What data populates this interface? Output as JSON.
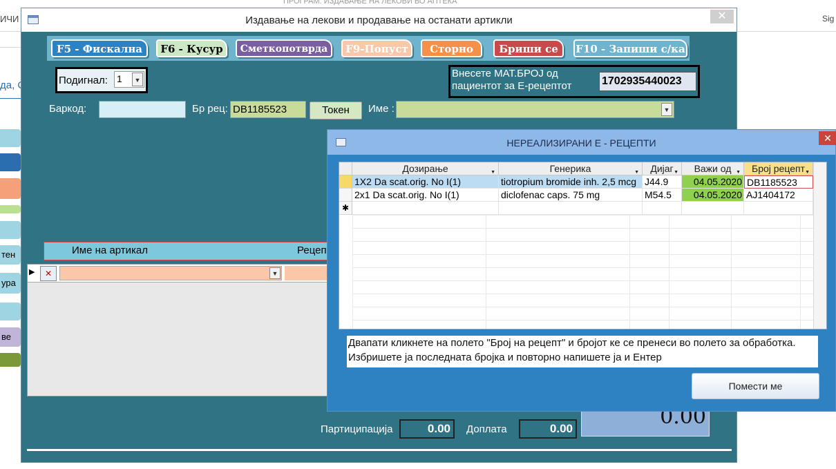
{
  "background_app": {
    "window_title": "ПРОГРАМ: ИЗДАВАЊЕ НА ЛЕКОВИ ВО АПТЕКА",
    "left_fragment": "ИЧИ",
    "top_right_fragment": "Sig",
    "side_fragment": "да, С",
    "side_buttons": [
      "",
      "",
      "",
      "",
      "",
      "тен",
      "ура",
      "",
      "ве",
      ""
    ]
  },
  "main_window": {
    "title": "Издавање на лекови и продавање на останати артикли",
    "close_label": "✕",
    "toolbar": {
      "fiscal": "F5 - Фискална",
      "change": "F6 - Кусур",
      "invoice": "Сметкопотврда",
      "discount": "F9-Попуст",
      "storno": "Сторно",
      "delete": "Бриши се",
      "save": "F10 - Запиши с/ка"
    },
    "raised_label": "Подигнал:",
    "raised_value": "1",
    "mat_label_line1": "Внесете МАТ.БРОЈ од",
    "mat_label_line2": "пациентот за Е-рецептот",
    "mat_value": "1702935440023",
    "barcode_label": "Баркод:",
    "barcode_value": "",
    "rec_no_label": "Бр рец:",
    "rec_no_value": "DB1185523",
    "token_button": "Токен",
    "name_label": "Име :",
    "name_value": "",
    "article_header": "Име на артикал",
    "recept_header": "Рецеп",
    "participation_label": "Партиципација",
    "participation_value": "0.00",
    "surcharge_label": "Доплата",
    "surcharge_value": "0.00",
    "total_value": "0.00"
  },
  "popup": {
    "title": "НЕРЕАЛИЗИРАНИ Е - РЕЦЕПТИ",
    "close_label": "✕",
    "columns": [
      "Дозирање",
      "Генерика",
      "Дијаг",
      "Важи од",
      "Број рецепт"
    ],
    "rows": [
      {
        "dosage": "1X2   Da scat.orig. No I(1)",
        "generic": "tiotropium bromide inh. 2,5 mcg",
        "diag": "J44.9",
        "valid_from": "04.05.2020",
        "rec_no": "DB1185523"
      },
      {
        "dosage": "2x1   Da scat.orig. No I(1)",
        "generic": "diclofenac caps. 75 mg",
        "diag": "M54.5",
        "valid_from": "04.05.2020",
        "rec_no": "AJ1404172"
      }
    ],
    "new_row_marker": "✱",
    "info_line1": "Двапати кликнете на полето \"Број на рецепт\"  и бројот ке се пренеси во полето за обработка.",
    "info_line2": "Избришете ја последната бројка и повторно напишете ја и Ентер",
    "place_button": "Помести ме"
  },
  "colors": {
    "form_teal": "#2f7384",
    "toolbar_bg": "#6fb3cd",
    "popup_blue": "#2e82c2",
    "valid_green": "#8fd14f",
    "field_green": "#c8dc9a",
    "article_orange": "#fac8a8"
  }
}
